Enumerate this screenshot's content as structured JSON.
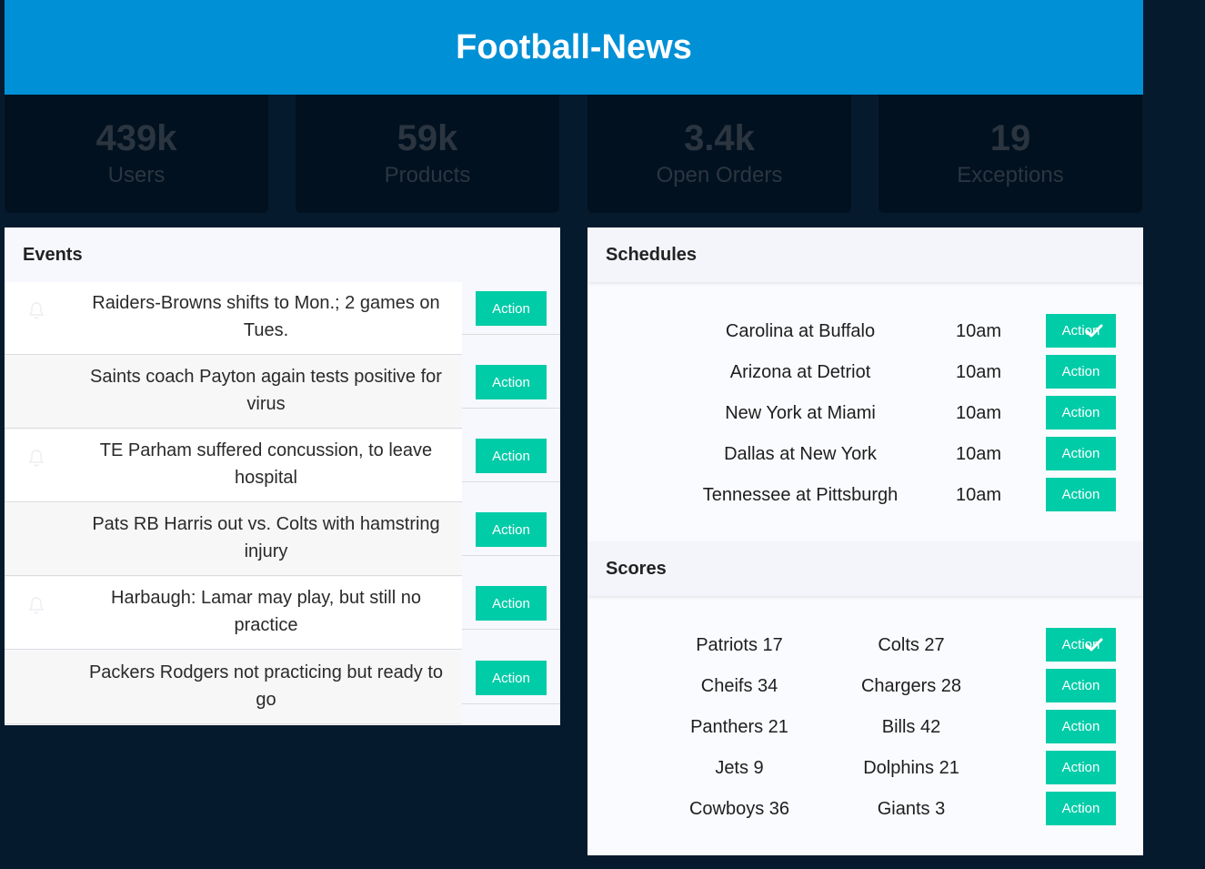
{
  "header": {
    "title": "Football-News"
  },
  "stats": [
    {
      "value": "439k",
      "label": "Users"
    },
    {
      "value": "59k",
      "label": "Products"
    },
    {
      "value": "3.4k",
      "label": "Open Orders"
    },
    {
      "value": "19",
      "label": "Exceptions"
    }
  ],
  "events": {
    "title": "Events",
    "items": [
      {
        "line1": "Raiders-Browns shifts to Mon.; 2 games on",
        "line2": "Tues.",
        "action": "Action"
      },
      {
        "line1": "Saints coach Payton again tests positive for",
        "line2": "virus",
        "action": "Action"
      },
      {
        "line1": "TE Parham suffered concussion, to leave",
        "line2": "hospital",
        "action": "Action"
      },
      {
        "line1": "Pats RB Harris out vs. Colts with hamstring",
        "line2": "injury",
        "action": "Action"
      },
      {
        "line1": "Harbaugh: Lamar may play, but still no",
        "line2": "practice",
        "action": "Action"
      },
      {
        "line1": "Packers Rodgers not practicing but ready to",
        "line2": "go",
        "action": "Action"
      }
    ]
  },
  "schedules": {
    "title": "Schedules",
    "items": [
      {
        "game": "Carolina at Buffalo",
        "time": "10am",
        "action": "Action",
        "checked": true
      },
      {
        "game": "Arizona at Detriot",
        "time": "10am",
        "action": "Action",
        "checked": false
      },
      {
        "game": "New York at Miami",
        "time": "10am",
        "action": "Action",
        "checked": false
      },
      {
        "game": "Dallas at New York",
        "time": "10am",
        "action": "Action",
        "checked": false
      },
      {
        "game": "Tennessee at Pittsburgh",
        "time": "10am",
        "action": "Action",
        "checked": false
      }
    ]
  },
  "scores": {
    "title": "Scores",
    "items": [
      {
        "home": "Patriots 17",
        "away": "Colts 27",
        "action": "Action",
        "checked": true
      },
      {
        "home": "Cheifs 34",
        "away": "Chargers 28",
        "action": "Action",
        "checked": false
      },
      {
        "home": "Panthers 21",
        "away": "Bills 42",
        "action": "Action",
        "checked": false
      },
      {
        "home": "Jets 9",
        "away": "Dolphins 21",
        "action": "Action",
        "checked": false
      },
      {
        "home": "Cowboys 36",
        "away": "Giants 3",
        "action": "Action",
        "checked": false
      }
    ]
  },
  "colors": {
    "header": "#0090d6",
    "action": "#00cca8",
    "background": "#061a2e"
  }
}
